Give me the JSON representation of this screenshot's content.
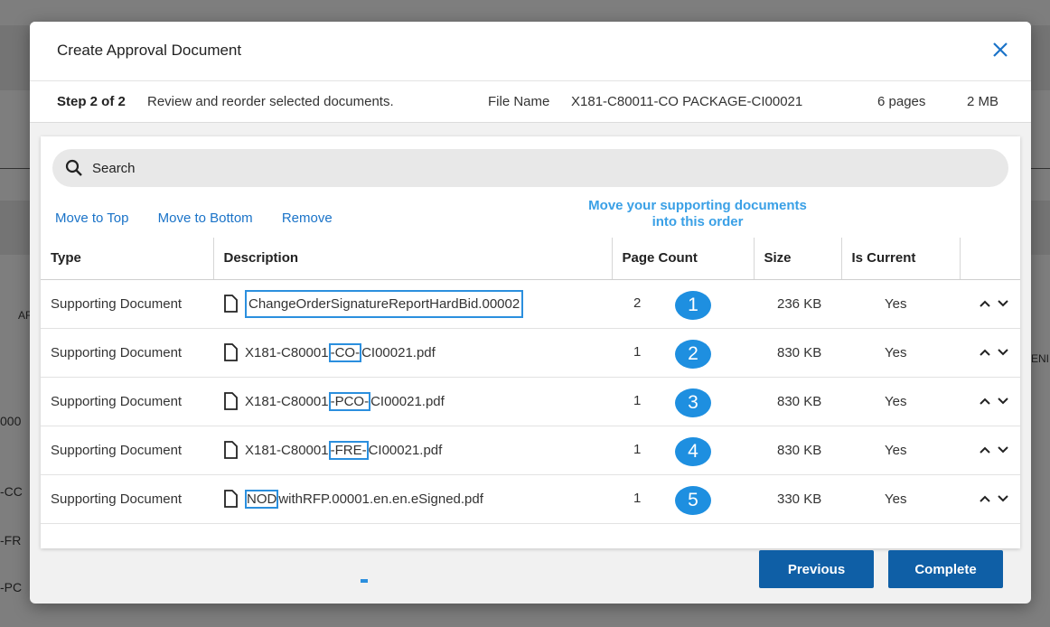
{
  "background": {
    "fragments": [
      "ARK",
      "000",
      "-CC",
      "-FR",
      "-PC",
      "ENI"
    ]
  },
  "dialog": {
    "title": "Create Approval Document",
    "step_label": "Step 2 of 2",
    "step_text": "Review and reorder selected documents.",
    "file_name_label": "File Name",
    "file_name": "X181-C80011-CO PACKAGE-CI00021",
    "pages": "6 pages",
    "size": "2 MB"
  },
  "search": {
    "placeholder": "Search"
  },
  "actions": {
    "move_top": "Move to Top",
    "move_bottom": "Move to Bottom",
    "remove": "Remove"
  },
  "hint": {
    "line1": "Move your supporting documents",
    "line2": "into this order"
  },
  "table": {
    "headers": [
      "Type",
      "Description",
      "Page Count",
      "Size",
      "Is Current"
    ],
    "rows": [
      {
        "type": "Supporting Document",
        "description": "ChangeOrderSignatureReportHardBid.00002",
        "count": "2",
        "order": "1",
        "size": "236 KB",
        "current": "Yes"
      },
      {
        "type": "Supporting Document",
        "pre": "X181-C80001",
        "mid": "-CO-",
        "post": "CI00021.pdf",
        "count": "1",
        "order": "2",
        "size": "830 KB",
        "current": "Yes"
      },
      {
        "type": "Supporting Document",
        "pre": "X181-C80001",
        "mid": "-PCO-",
        "post": "CI00021.pdf",
        "count": "1",
        "order": "3",
        "size": "830 KB",
        "current": "Yes"
      },
      {
        "type": "Supporting Document",
        "pre": "X181-C80001",
        "mid": "-FRE-",
        "post": "CI00021.pdf",
        "count": "1",
        "order": "4",
        "size": "830 KB",
        "current": "Yes"
      },
      {
        "type": "Supporting Document",
        "pre": "",
        "mid": "NOD",
        "post": "withRFP.00001.en.en.eSigned.pdf",
        "count": "1",
        "order": "5",
        "size": "330 KB",
        "current": "Yes"
      }
    ]
  },
  "buttons": {
    "previous": "Previous",
    "complete": "Complete"
  },
  "colors": {
    "primary": "#0f5fa6",
    "link": "#1a73c8",
    "badge": "#1e8fe0",
    "highlight": "#2b8fde"
  },
  "icons": [
    "close-icon",
    "search-icon",
    "document-icon",
    "chevron-up-icon",
    "chevron-down-icon"
  ]
}
